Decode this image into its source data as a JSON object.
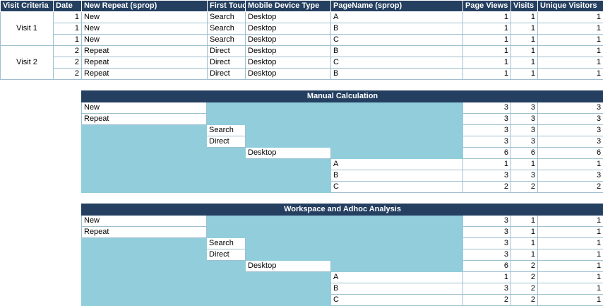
{
  "top": {
    "headers": [
      "Visit Criteria",
      "Date",
      "New Repeat (sprop)",
      "First Touc",
      "Mobile Device Type",
      "PageName (sprop)",
      "Page Views",
      "Visits",
      "Unique Visitors"
    ],
    "groups": [
      {
        "label": "Visit 1",
        "rows": [
          [
            "1",
            "New",
            "Search",
            "Desktop",
            "A",
            "1",
            "1",
            "1"
          ],
          [
            "1",
            "New",
            "Search",
            "Desktop",
            "B",
            "1",
            "1",
            "1"
          ],
          [
            "1",
            "New",
            "Search",
            "Desktop",
            "C",
            "1",
            "1",
            "1"
          ]
        ]
      },
      {
        "label": "Visit 2",
        "rows": [
          [
            "2",
            "Repeat",
            "Direct",
            "Desktop",
            "B",
            "1",
            "1",
            "1"
          ],
          [
            "2",
            "Repeat",
            "Direct",
            "Desktop",
            "C",
            "1",
            "1",
            "1"
          ],
          [
            "2",
            "Repeat",
            "Direct",
            "Desktop",
            "B",
            "1",
            "1",
            "1"
          ]
        ]
      }
    ]
  },
  "manual": {
    "title": "Manual Calculation",
    "rows": [
      {
        "label": "New",
        "col": 0,
        "values": [
          "3",
          "3",
          "3"
        ]
      },
      {
        "label": "Repeat",
        "col": 0,
        "values": [
          "3",
          "3",
          "3"
        ]
      },
      {
        "label": "Search",
        "col": 1,
        "values": [
          "3",
          "3",
          "3"
        ]
      },
      {
        "label": "Direct",
        "col": 1,
        "values": [
          "3",
          "3",
          "3"
        ]
      },
      {
        "label": "Desktop",
        "col": 2,
        "values": [
          "6",
          "6",
          "6"
        ]
      },
      {
        "label": "A",
        "col": 3,
        "values": [
          "1",
          "1",
          "1"
        ]
      },
      {
        "label": "B",
        "col": 3,
        "values": [
          "3",
          "3",
          "3"
        ]
      },
      {
        "label": "C",
        "col": 3,
        "values": [
          "2",
          "2",
          "2"
        ]
      }
    ]
  },
  "workspace": {
    "title": "Workspace and Adhoc Analysis",
    "rows": [
      {
        "label": "New",
        "col": 0,
        "values": [
          "3",
          "1",
          "1"
        ]
      },
      {
        "label": "Repeat",
        "col": 0,
        "values": [
          "3",
          "1",
          "1"
        ]
      },
      {
        "label": "Search",
        "col": 1,
        "values": [
          "3",
          "1",
          "1"
        ]
      },
      {
        "label": "Direct",
        "col": 1,
        "values": [
          "3",
          "1",
          "1"
        ]
      },
      {
        "label": "Desktop",
        "col": 2,
        "values": [
          "6",
          "2",
          "1"
        ]
      },
      {
        "label": "A",
        "col": 3,
        "values": [
          "1",
          "2",
          "1"
        ]
      },
      {
        "label": "B",
        "col": 3,
        "values": [
          "3",
          "2",
          "1"
        ]
      },
      {
        "label": "C",
        "col": 3,
        "values": [
          "2",
          "2",
          "1"
        ]
      }
    ]
  }
}
